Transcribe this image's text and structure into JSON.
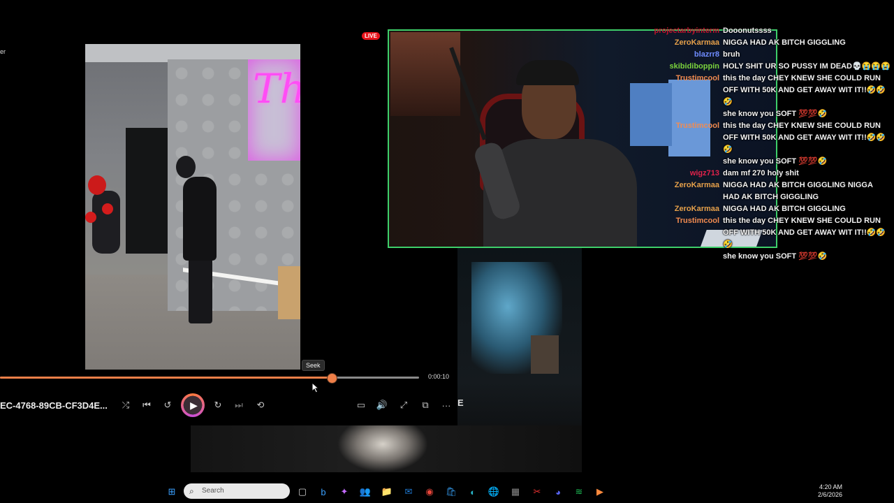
{
  "player": {
    "window_title": "er",
    "media_title": "EC-4768-89CB-CF3D4E...",
    "seek_tooltip": "Seek",
    "time_total": "0:00:10",
    "progress": 0.79
  },
  "window_controls": {
    "minimize": "─",
    "maximize": "☐",
    "close": "✕"
  },
  "controls": {
    "shuffle": "⤮",
    "previous": "⏮",
    "skip_back": "↺",
    "play": "▶",
    "skip_forward": "↻",
    "next": "⏭",
    "repeat": "⟲",
    "captions": "▭",
    "volume": "🔊",
    "fullscreen": "⤢",
    "miniplayer": "⧉",
    "more": "···"
  },
  "live_badge": "LIVE",
  "dim_window_letter": "E",
  "chat": [
    {
      "user": "projectarbyinterm",
      "color": "#c0142b",
      "text": "Dooonutssss"
    },
    {
      "user": "ZeroKarmaa",
      "color": "#e6a04a",
      "text": "NIGGA HAD AK BITCH GIGGLING"
    },
    {
      "user": "blazrr8",
      "color": "#6f8cff",
      "text": "bruh"
    },
    {
      "user": "skibidiboppin",
      "color": "#7bd33d",
      "text": "HOLY SHIT UR SO PUSSY IM DEAD💀😭😭😭"
    },
    {
      "user": "Trustimcool",
      "color": "#f28b50",
      "text": "this the day CHEY KNEW SHE COULD RUN OFF WITH 50K AND GET AWAY WIT IT!!🤣🤣🤣"
    },
    {
      "user": "",
      "color": "#f28b50",
      "text": "she know you SOFT 💯💯🤣"
    },
    {
      "user": "Trustimcool",
      "color": "#f28b50",
      "text": "this the day CHEY KNEW SHE COULD RUN OFF WITH 50K AND GET AWAY WIT IT!!🤣🤣🤣"
    },
    {
      "user": "",
      "color": "#f28b50",
      "text": "she know you SOFT 💯💯🤣"
    },
    {
      "user": "wigz713",
      "color": "#e0224a",
      "text": "dam mf 270 holy shit"
    },
    {
      "user": "ZeroKarmaa",
      "color": "#e6a04a",
      "text": "NIGGA HAD AK BITCH GIGGLING NIGGA HAD AK BITCH GIGGLING"
    },
    {
      "user": "ZeroKarmaa",
      "color": "#e6a04a",
      "text": "NIGGA HAD AK BITCH GIGGLING"
    },
    {
      "user": "Trustimcool",
      "color": "#f28b50",
      "text": "this the day CHEY KNEW SHE COULD RUN OFF WITH 50K AND GET AWAY WIT IT!!🤣🤣🤣"
    },
    {
      "user": "",
      "color": "#f28b50",
      "text": "she know you SOFT 💯💯🤣"
    }
  ],
  "taskbar": {
    "search_placeholder": "Search",
    "time": "4:20 AM",
    "date": "2/6/2026",
    "icons": [
      {
        "name": "start-icon",
        "glyph": "⊞",
        "color": "#3aa0ff"
      },
      {
        "name": "task-view-icon",
        "glyph": "▢",
        "color": "#cfcfcf"
      },
      {
        "name": "bing-icon",
        "glyph": "b",
        "color": "#3aa0ff"
      },
      {
        "name": "copilot-icon",
        "glyph": "✦",
        "color": "#c46bff"
      },
      {
        "name": "teams-icon",
        "glyph": "👥",
        "color": "#7b83eb"
      },
      {
        "name": "file-explorer-icon",
        "glyph": "📁",
        "color": "#f2c84b"
      },
      {
        "name": "outlook-icon",
        "glyph": "✉",
        "color": "#1f7bd6"
      },
      {
        "name": "chrome-icon",
        "glyph": "◉",
        "color": "#e6453a"
      },
      {
        "name": "store-icon",
        "glyph": "🛍",
        "color": "#2f8bd6"
      },
      {
        "name": "edge-icon",
        "glyph": "◐",
        "color": "#28b5c8"
      },
      {
        "name": "browser-icon",
        "glyph": "🌐",
        "color": "#3ec1d3"
      },
      {
        "name": "calculator-icon",
        "glyph": "▦",
        "color": "#8a8a8a"
      },
      {
        "name": "snipping-tool-icon",
        "glyph": "✂",
        "color": "#e33"
      },
      {
        "name": "discord-icon",
        "glyph": "◕",
        "color": "#5865f2"
      },
      {
        "name": "spotify-icon",
        "glyph": "≋",
        "color": "#1db954"
      },
      {
        "name": "media-player-icon",
        "glyph": "▶",
        "color": "#ff8a3d"
      }
    ]
  }
}
